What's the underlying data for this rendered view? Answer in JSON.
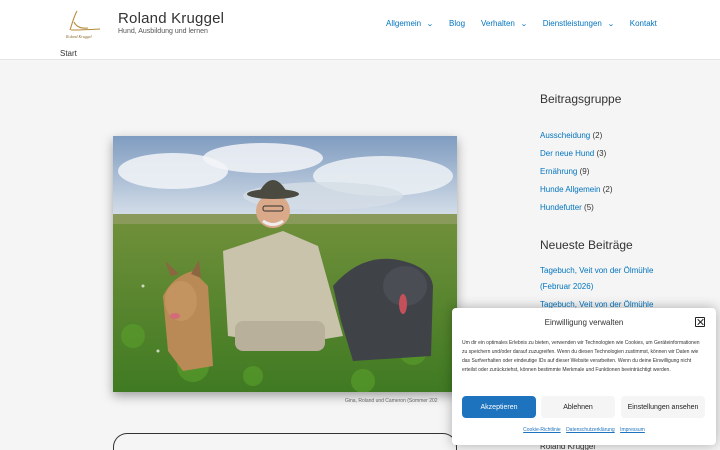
{
  "header": {
    "logo_text": "Roland Kruggel",
    "site_title": "Roland Kruggel",
    "tagline": "Hund, Ausbildung und lernen",
    "nav": [
      {
        "label": "Allgemein",
        "has_dropdown": true
      },
      {
        "label": "Blog",
        "has_dropdown": false
      },
      {
        "label": "Verhalten",
        "has_dropdown": true
      },
      {
        "label": "Dienstleistungen",
        "has_dropdown": true
      },
      {
        "label": "Kontakt",
        "has_dropdown": false
      }
    ],
    "link_color": "#0274be"
  },
  "breadcrumb": "Start",
  "main": {
    "photo_caption": "Gina, Roland und Cameron (Sommer 202"
  },
  "sidebar": {
    "categories_title": "Beitragsgruppe",
    "categories": [
      {
        "label": "Ausscheidung",
        "count": "(2)"
      },
      {
        "label": "Der neue Hund",
        "count": "(3)"
      },
      {
        "label": "Ernährung",
        "count": "(9)"
      },
      {
        "label": "Hunde Allgemein",
        "count": "(2)"
      },
      {
        "label": "Hundefutter",
        "count": "(5)"
      }
    ],
    "recent_title": "Neueste Beiträge",
    "recent_posts": [
      "Tagebuch, Veit von der Ölmühle",
      "(Februar 2026)",
      "Tagebuch, Veit von der Ölmühle"
    ],
    "partial_author": "Roland Kruggel"
  },
  "consent": {
    "title": "Einwilligung verwalten",
    "text": "Um dir ein optimales Erlebnis zu bieten, verwenden wir Technologien wie Cookies, um Geräteinformationen zu speichern und/oder darauf zuzugreifen. Wenn du diesen Technologien zustimmst, können wir Daten wie das Surfverhalten oder eindeutige IDs auf dieser Website verarbeiten. Wenn du deine Einwilligung nicht erteilst oder zurückziehst, können bestimmte Merkmale und Funktionen beeinträchtigt werden.",
    "accept_label": "Akzeptieren",
    "deny_label": "Ablehnen",
    "settings_label": "Einstellungen ansehen",
    "links": [
      "Cookie-Richtlinie",
      "Datenschutzerklärung",
      "Impressum"
    ],
    "accent_color": "#1e73be"
  },
  "icons": {
    "dropdown": "chevron-down-icon",
    "close": "close-icon",
    "logo": "handwritten-logo"
  }
}
